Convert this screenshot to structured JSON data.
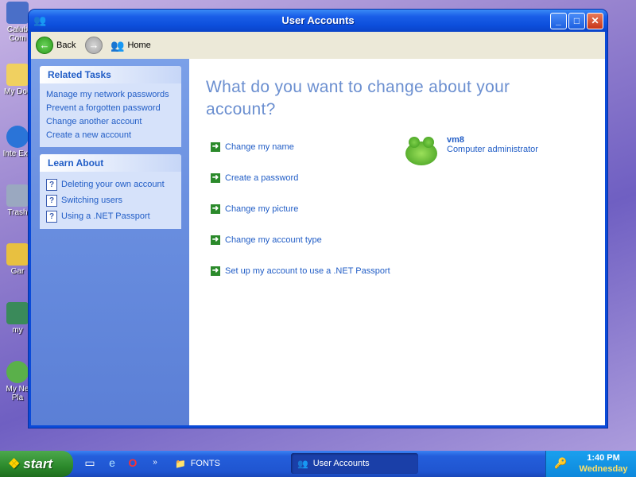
{
  "desktop": {
    "icons": [
      {
        "label": "Calub Com",
        "icon": "computer-icon"
      },
      {
        "label": "My Doc",
        "icon": "folder-icon"
      },
      {
        "label": "Inte Exp",
        "icon": "internet-explorer-icon"
      },
      {
        "label": "Trash",
        "icon": "recycle-bin-icon"
      },
      {
        "label": "Gar",
        "icon": "games-icon"
      },
      {
        "label": "my",
        "icon": "user-icon"
      },
      {
        "label": "My Ne Pla",
        "icon": "network-icon"
      }
    ]
  },
  "window": {
    "title": "User Accounts",
    "minimize": "_",
    "maximize": "□",
    "close": "✕"
  },
  "toolbar": {
    "back_label": "Back",
    "forward_label": "",
    "home_label": "Home"
  },
  "sidebar": {
    "related_tasks": {
      "title": "Related Tasks",
      "items": [
        "Manage my network passwords",
        "Prevent a forgotten password",
        "Change another account",
        "Create a new account"
      ]
    },
    "learn_about": {
      "title": "Learn About",
      "items": [
        "Deleting your own account",
        "Switching users",
        "Using a .NET Passport"
      ]
    }
  },
  "main": {
    "heading": "What do you want to change about your account?",
    "tasks": [
      "Change my name",
      "Create a password",
      "Change my picture",
      "Change my account type",
      "Set up my account to use a .NET Passport"
    ],
    "account": {
      "name": "vm8",
      "type": "Computer administrator"
    }
  },
  "taskbar": {
    "start_label": "start",
    "fonts_label": "FONTS",
    "user_accounts_label": "User Accounts",
    "time": "1:40 PM",
    "day": "Wednesday"
  },
  "colors": {
    "link": "#215dc6",
    "heading": "#6b8fd0",
    "titlebar": "#0d4fdc",
    "sidebar": "#6a8fe0"
  }
}
